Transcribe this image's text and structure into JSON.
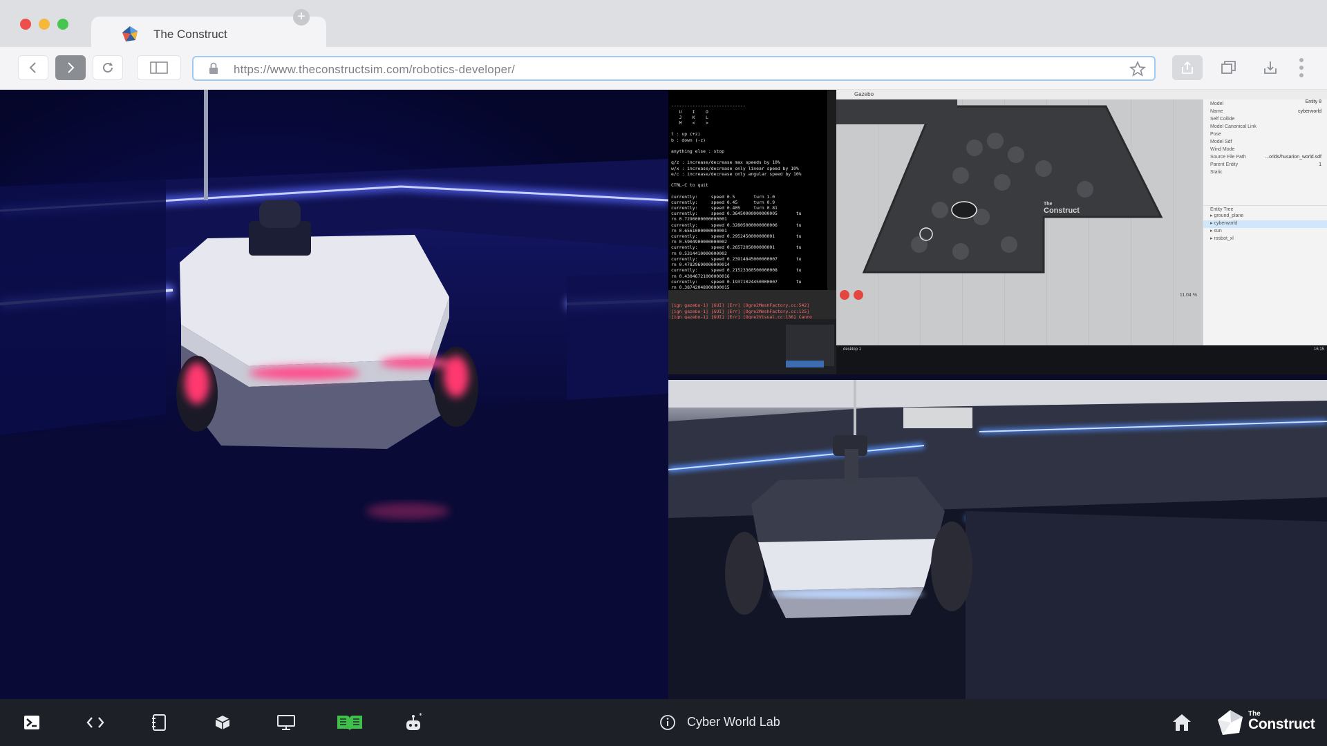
{
  "browser": {
    "tab_title": "The Construct",
    "url": "https://www.theconstructsim.com/robotics-developer/"
  },
  "terminal": {
    "lines": [
      "----------------------------",
      "   U    I    O",
      "   J    K    L",
      "   M    <    >",
      "",
      "t : up (+z)",
      "b : down (-z)",
      "",
      "anything else : stop",
      "",
      "q/z : increase/decrease max speeds by 10%",
      "w/x : increase/decrease only linear speed by 10%",
      "e/c : increase/decrease only angular speed by 10%",
      "",
      "CTRL-C to quit",
      "",
      "currently:     speed 0.5       turn 1.0",
      "currently:     speed 0.45      turn 0.9",
      "currently:     speed 0.405     turn 0.81",
      "currently:     speed 0.36450000000000005       tu",
      "rn 0.7290000000000001",
      "currently:     speed 0.32805000000000006       tu",
      "rn 0.6561000000000001",
      "currently:     speed 0.2952450000000001        tu",
      "rn 0.5904900000000002",
      "currently:     speed 0.2657205000000001        tu",
      "rn 0.5314410000000002",
      "currently:     speed 0.23914845000000007       tu",
      "rn 0.47829690000000014",
      "currently:     speed 0.21523360500000008       tu",
      "rn 0.43046721000000016",
      "currently:     speed 0.19371024450000007       tu",
      "rn 0.38742048900000015"
    ],
    "errors": [
      "[ign gazebo-1] [GUI] [Err] [Ogre2MeshFactory.cc:542]",
      "[ign gazebo-1] [GUI] [Err] [Ogre2MeshFactory.cc:125]",
      "[ign gazebo-1] [GUI] [Err] [Ogre2Visual.cc:136] Canno"
    ]
  },
  "gazebo": {
    "title": "Gazebo",
    "panel_header": "Model",
    "panel_header_right": "Entity 8",
    "properties": [
      {
        "k": "Name",
        "v": "cyberworld"
      },
      {
        "k": "Self Collide",
        "v": ""
      },
      {
        "k": "Model Canonical Link",
        "v": ""
      },
      {
        "k": "Pose",
        "v": ""
      },
      {
        "k": "Model Sdf",
        "v": ""
      },
      {
        "k": "Wind Mode",
        "v": ""
      },
      {
        "k": "Source File Path",
        "v": "...orlds/husarion_world.sdf"
      },
      {
        "k": "Parent Entity",
        "v": "1"
      },
      {
        "k": "Static",
        "v": ""
      }
    ],
    "entity_tree_title": "Entity Tree",
    "entity_tree": [
      "ground_plane",
      "cyberworld",
      "sun",
      "rosbot_xl"
    ],
    "zoom": "11.04 %",
    "taskbar_text": "desktop 1",
    "clock": "16:15"
  },
  "overlay_logo_word1": "The",
  "overlay_logo_word2": "Construct",
  "bottom": {
    "lab_title": "Cyber World Lab",
    "logo_word1": "The",
    "logo_word2": "Construct"
  }
}
